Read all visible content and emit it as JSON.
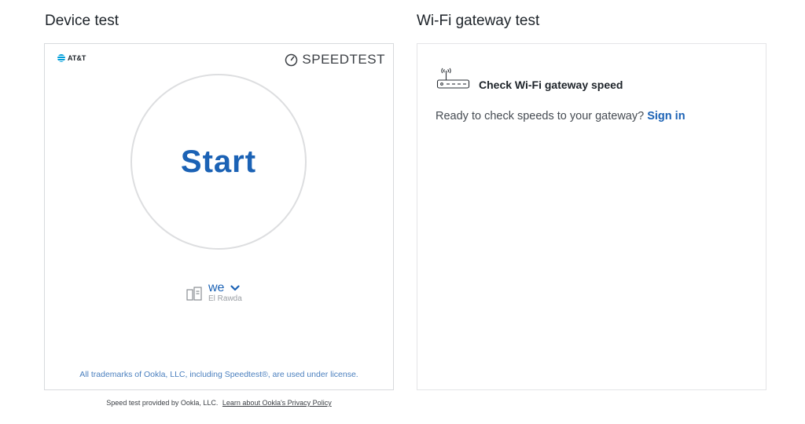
{
  "device_test": {
    "title": "Device test",
    "brand": "AT&T",
    "speedtest_logo": "SPEEDTEST",
    "start_label": "Start",
    "provider": {
      "name": "we",
      "location": "El Rawda"
    },
    "trademark_notice": "All trademarks of Ookla, LLC, including Speedtest®, are used under license.",
    "footer_text": "Speed test provided by Ookla, LLC.",
    "footer_link": "Learn about Ookla's Privacy Policy"
  },
  "wifi_test": {
    "title": "Wi-Fi gateway test",
    "header_label": "Check Wi-Fi gateway speed",
    "description": "Ready to check speeds to your gateway?",
    "sign_in_label": "Sign in"
  },
  "icons": {
    "brand": "att-globe-icon",
    "speedtest": "speedometer-icon",
    "provider": "server-icon",
    "provider_dropdown": "chevron-down-icon",
    "gateway": "router-icon"
  },
  "colors": {
    "accent": "#1b62b5",
    "att_blue": "#009fdb",
    "border": "#d8dadd",
    "circle_border": "#dddee0",
    "muted_text": "#9a9ea3"
  }
}
